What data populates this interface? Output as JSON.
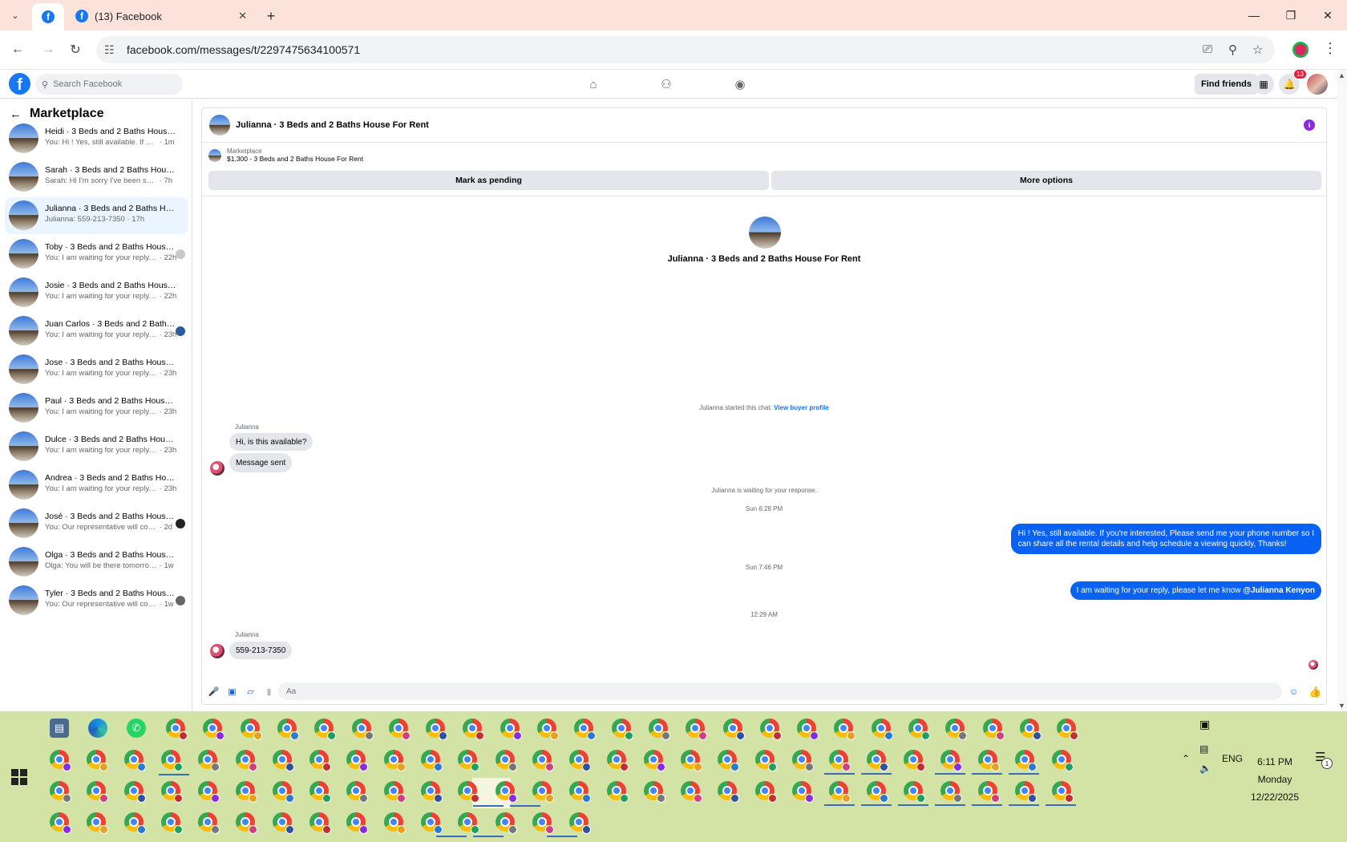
{
  "browser": {
    "tab_title": "(13) Facebook",
    "url": "facebook.com/messages/t/2297475634100571",
    "icons": [
      "tab-list-icon",
      "facebook-icon",
      "close-icon",
      "plus-icon",
      "minimize-icon",
      "restore-icon",
      "close-window-icon",
      "back-icon",
      "forward-icon",
      "reload-icon",
      "site-settings-icon",
      "install-icon",
      "zoom-icon",
      "bookmark-star-icon",
      "profile-icon",
      "menu-icon"
    ]
  },
  "fb": {
    "search_placeholder": "Search Facebook",
    "find_friends": "Find friends",
    "notif_count": "13"
  },
  "sidebar": {
    "title": "Marketplace",
    "items": [
      {
        "name": "Heidi · 3 Beds and 2 Baths House For Rent",
        "preview": "You: Hi ! Yes, still available. If you're interested",
        "time": "1m",
        "mini": ""
      },
      {
        "name": "Sarah · 3 Beds and 2 Baths House For Rent",
        "preview": "Sarah: Hi I'm sorry I've been so busy lately",
        "time": "7h",
        "mini": ""
      },
      {
        "name": "Julianna · 3 Beds and 2 Baths House For Rent",
        "preview": "Julianna: 559-213-7350",
        "time": "17h",
        "mini": "",
        "active": true
      },
      {
        "name": "Toby · 3 Beds and 2 Baths House For Rent",
        "preview": "You: I am waiting for your reply, please",
        "time": "22h",
        "mini": "#c8c8c8"
      },
      {
        "name": "Josie · 3 Beds and 2 Baths House For Rent",
        "preview": "You: I am waiting for your reply, please",
        "time": "22h",
        "mini": ""
      },
      {
        "name": "Juan Carlos · 3 Beds and 2 Baths House For Rent",
        "preview": "You: I am waiting for your reply, pl...",
        "time": "23h",
        "mini": "#2a5aa0"
      },
      {
        "name": "Jose · 3 Beds and 2 Baths House For Rent",
        "preview": "You: I am waiting for your reply, please",
        "time": "23h",
        "mini": ""
      },
      {
        "name": "Paul · 3 Beds and 2 Baths House For Rent",
        "preview": "You: I am waiting for your reply, please",
        "time": "23h",
        "mini": ""
      },
      {
        "name": "Dulce · 3 Beds and 2 Baths House For Rent",
        "preview": "You: I am waiting for your reply, please",
        "time": "23h",
        "mini": ""
      },
      {
        "name": "Andrea · 3 Beds and 2 Baths House For Rent",
        "preview": "You: I am waiting for your reply, please",
        "time": "23h",
        "mini": ""
      },
      {
        "name": "José · 3 Beds and 2 Baths House For Rent",
        "preview": "You: Our representative will contact you",
        "time": "2d",
        "mini": "#222"
      },
      {
        "name": "Olga · 3 Beds and 2 Baths House For Rent",
        "preview": "Olga: You will be there tomorrow at 1",
        "time": "1w",
        "mini": ""
      },
      {
        "name": "Tyler · 3 Beds and 2 Baths House For Rent",
        "preview": "You: Our representative will contact you",
        "time": "1w",
        "mini": "#666"
      }
    ]
  },
  "chat": {
    "title": "Julianna · 3 Beds and 2 Baths House For Rent",
    "listing_label": "Marketplace",
    "listing_price": "$1,300 - 3 Beds and 2 Baths House For Rent",
    "mark_pending": "Mark as pending",
    "more_options": "More options",
    "started_text": "Julianna started this chat.",
    "view_buyer": "View buyer profile",
    "sender_name": "Julianna",
    "msg1": "Hi, is this available?",
    "msg2": "Message sent",
    "waiting_text": "Julianna is waiting for your response.",
    "ts1": "Sun 6:28 PM",
    "out1_line1": "Hi ! Yes, still available. If you're interested, Please send me your phone number so I",
    "out1_line2": "can share all the rental details and help schedule a viewing quickly, Thanks!",
    "ts2": "Sun 7:46 PM",
    "out2_text": "I am waiting for your reply, please let me know",
    "out2_mention": "@Julianna Kenyon",
    "ts3": "12:29 AM",
    "msg3": "559-213-7350",
    "composer_placeholder": "Aa",
    "accent": "#0a62f5"
  },
  "taskbar": {
    "lang": "ENG",
    "time": "6:11 PM",
    "day": "Monday",
    "date": "12/22/2025",
    "notif_count": "1"
  }
}
